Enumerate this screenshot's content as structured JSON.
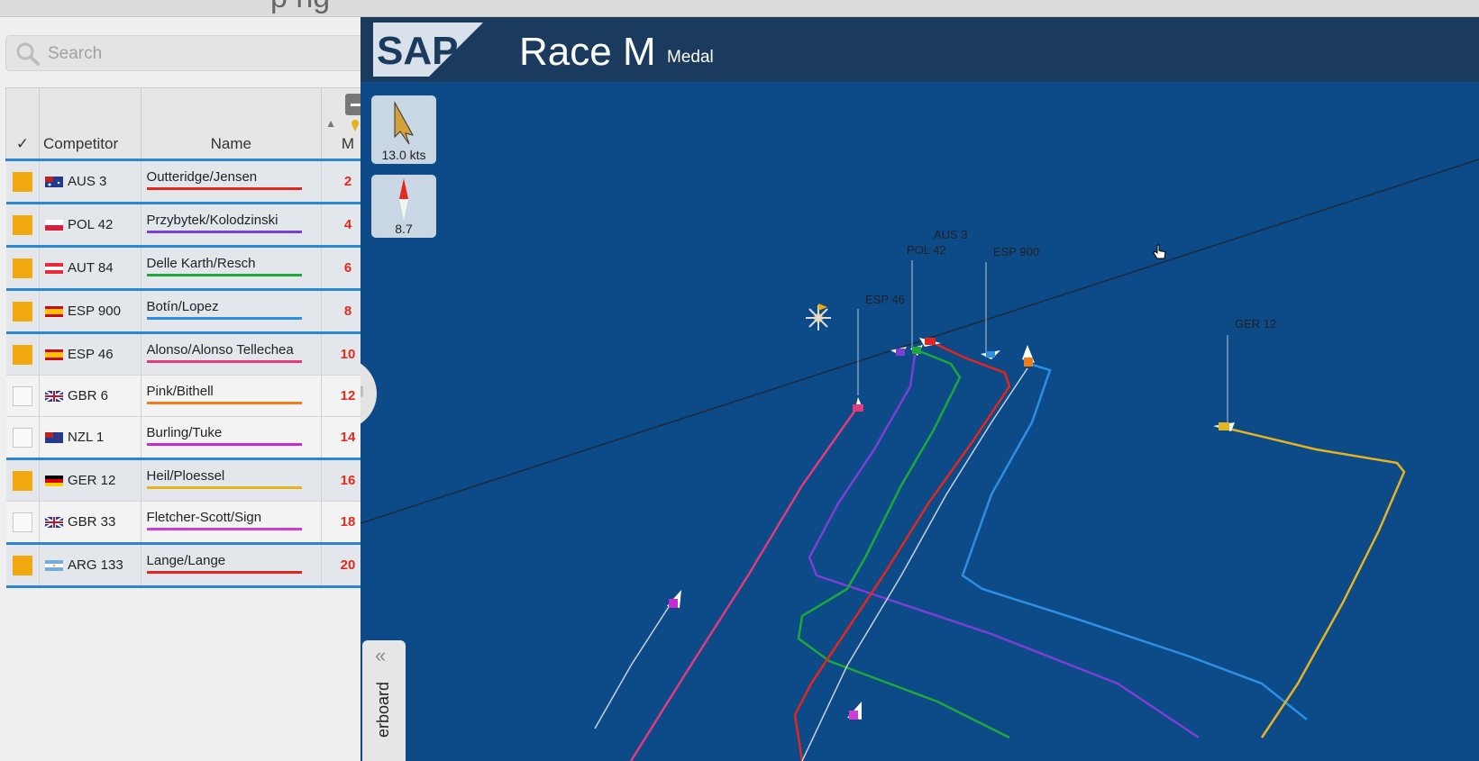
{
  "window_title_fragment": "p ng",
  "search": {
    "placeholder": "Search"
  },
  "table": {
    "headers": {
      "check": "✓",
      "competitor": "Competitor",
      "name": "Name",
      "points": "M"
    },
    "rows": [
      {
        "selected": true,
        "flag": "AUS",
        "sail": "AUS 3",
        "name": "Outteridge/Jensen",
        "points": "2",
        "color": "#e3261e"
      },
      {
        "selected": true,
        "flag": "POL",
        "sail": "POL 42",
        "name": "Przybytek/Kolodzinski",
        "points": "4",
        "color": "#7b3fd4"
      },
      {
        "selected": true,
        "flag": "AUT",
        "sail": "AUT 84",
        "name": "Delle Karth/Resch",
        "points": "6",
        "color": "#1ea83a"
      },
      {
        "selected": true,
        "flag": "ESP",
        "sail": "ESP 900",
        "name": "Botín/Lopez",
        "points": "8",
        "color": "#2d8fe3"
      },
      {
        "selected": true,
        "flag": "ESP",
        "sail": "ESP 46",
        "name": "Alonso/Alonso Tellechea",
        "points": "10",
        "color": "#e23a7c"
      },
      {
        "selected": false,
        "flag": "GBR",
        "sail": "GBR 6",
        "name": "Pink/Bithell",
        "points": "12",
        "color": "#f07d1a"
      },
      {
        "selected": false,
        "flag": "NZL",
        "sail": "NZL 1",
        "name": "Burling/Tuke",
        "points": "14",
        "color": "#c62ad0"
      },
      {
        "selected": true,
        "flag": "GER",
        "sail": "GER 12",
        "name": "Heil/Ploessel",
        "points": "16",
        "color": "#e7b421"
      },
      {
        "selected": false,
        "flag": "GBR",
        "sail": "GBR 33",
        "name": "Fletcher-Scott/Sign",
        "points": "18",
        "color": "#d23ad8"
      },
      {
        "selected": true,
        "flag": "ARG",
        "sail": "ARG 133",
        "name": "Lange/Lange",
        "points": "20",
        "color": "#e3261e"
      }
    ]
  },
  "map": {
    "logo": "SAP",
    "race_title": "Race M",
    "race_subtitle": "Medal",
    "wind_speed": "13.0 kts",
    "compass_value": "8.7",
    "leaderboard_tab": "erboard",
    "boat_labels": [
      "AUS 3",
      "POL 42",
      "ESP 900",
      "ESP 46",
      "GER 12"
    ]
  },
  "colors": {
    "accent": "#2c86d2",
    "selected_box": "#f2a90f",
    "map_bg": "#0d4a88",
    "header_bg": "#1a3b5e"
  }
}
